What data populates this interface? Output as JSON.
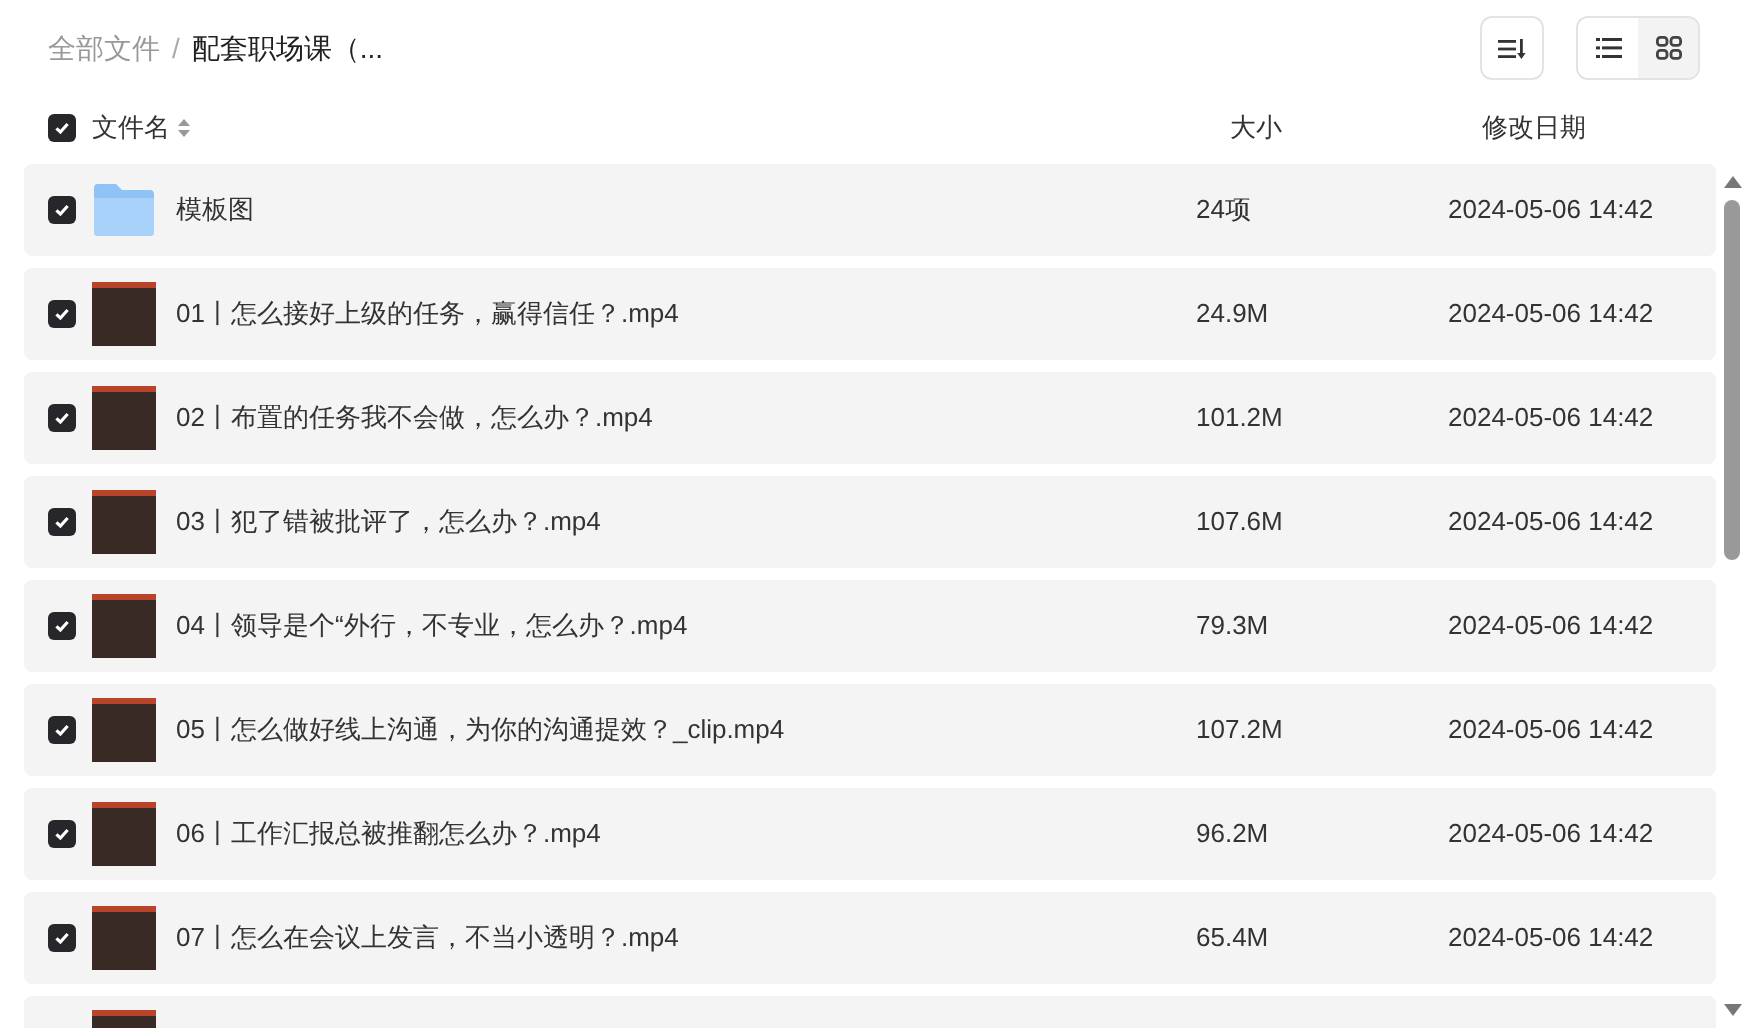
{
  "breadcrumb_separator": "/",
  "breadcrumb": [
    {
      "label": "全部文件",
      "current": false
    },
    {
      "label": "配套职场课（...",
      "current": true
    }
  ],
  "view_toggle": [
    {
      "kind": "list",
      "selected": true
    },
    {
      "kind": "grid",
      "selected": false
    }
  ],
  "table": {
    "select_all": {
      "checked": true
    },
    "columns": [
      "文件名",
      "大小",
      "修改日期"
    ],
    "rows": [
      {
        "kind": "folder",
        "checked": true,
        "name": "模板图",
        "size": "24项",
        "date": "2024-05-06 14:42"
      },
      {
        "kind": "video",
        "checked": true,
        "name": "01丨怎么接好上级的任务，赢得信任？.mp4",
        "size": "24.9M",
        "date": "2024-05-06 14:42"
      },
      {
        "kind": "video",
        "checked": true,
        "name": "02丨布置的任务我不会做，怎么办？.mp4",
        "size": "101.2M",
        "date": "2024-05-06 14:42"
      },
      {
        "kind": "video",
        "checked": true,
        "name": "03丨犯了错被批评了，怎么办？.mp4",
        "size": "107.6M",
        "date": "2024-05-06 14:42"
      },
      {
        "kind": "video",
        "checked": true,
        "name": "04丨领导是个“外行，不专业，怎么办？.mp4",
        "size": "79.3M",
        "date": "2024-05-06 14:42"
      },
      {
        "kind": "video",
        "checked": true,
        "name": "05丨怎么做好线上沟通，为你的沟通提效？_clip.mp4",
        "size": "107.2M",
        "date": "2024-05-06 14:42"
      },
      {
        "kind": "video",
        "checked": true,
        "name": "06丨工作汇报总被推翻怎么办？.mp4",
        "size": "96.2M",
        "date": "2024-05-06 14:42"
      },
      {
        "kind": "video",
        "checked": true,
        "name": "07丨怎么在会议上发言，不当小透明？.mp4",
        "size": "65.4M",
        "date": "2024-05-06 14:42"
      },
      {
        "kind": "video"
      }
    ]
  }
}
